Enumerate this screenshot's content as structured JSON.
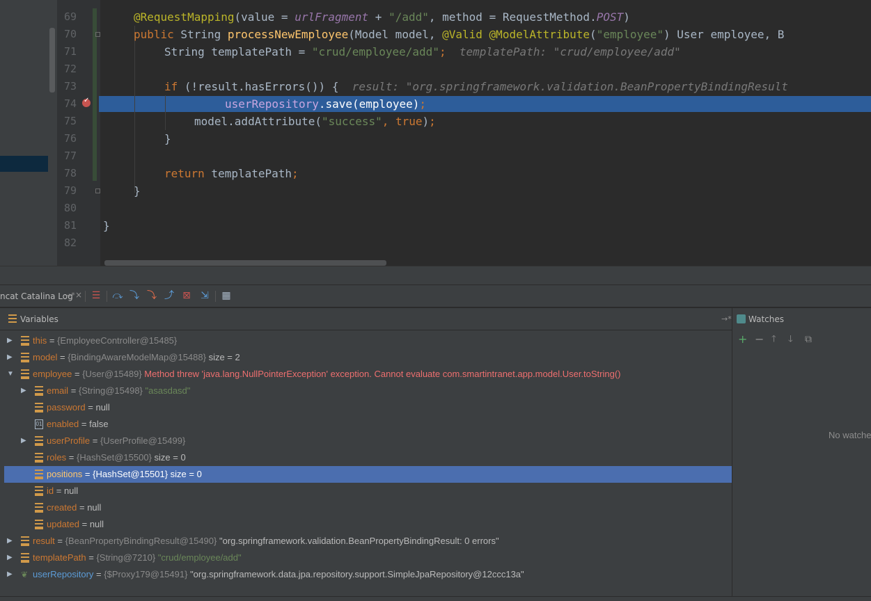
{
  "editor": {
    "line_numbers": [
      "69",
      "70",
      "71",
      "72",
      "73",
      "74",
      "75",
      "76",
      "77",
      "78",
      "79",
      "80",
      "81",
      "82"
    ],
    "line_69": {
      "annotation": "@RequestMapping",
      "p1": "(value = ",
      "frag": "urlFragment",
      "p2": " + ",
      "add": "\"/add\"",
      "p3": ", method = RequestMethod.",
      "post": "POST",
      "p4": ")"
    },
    "line_70": {
      "kw1": "public",
      "p1": " String ",
      "fn": "processNewEmployee",
      "p2": "(Model model, ",
      "an1": "@Valid",
      "sp": " ",
      "an2": "@ModelAttribute",
      "p3": "(",
      "str": "\"employee\"",
      "p4": ") User employee, B"
    },
    "line_71": {
      "p1": "String templatePath = ",
      "str": "\"crud/employee/add\"",
      "semi": ";",
      "hint": "  templatePath: \"crud/employee/add\""
    },
    "line_73": {
      "kw": "if",
      "p1": " (!result.hasErrors()) {",
      "hint": "  result: \"org.springframework.validation.BeanPropertyBindingResult"
    },
    "line_74": {
      "field": "userRepository",
      "p1": ".save(employee)",
      "semi": ";"
    },
    "line_75": {
      "p1": "model.addAttribute(",
      "str": "\"success\"",
      "comma": ", ",
      "kw": "true",
      "p2": ")",
      "semi": ";"
    },
    "line_76": "}",
    "line_78": {
      "kw": "return",
      "p1": " templatePath",
      "semi": ";"
    },
    "line_79": "}",
    "line_81": "}"
  },
  "debugger": {
    "tab_label": "ncat Catalina Log",
    "tab_pin": "→*",
    "tab_close": "×",
    "toolbar_icons": [
      "show-execution-point-icon",
      "step-over-icon",
      "step-into-icon",
      "force-step-into-icon",
      "step-out-icon",
      "drop-frame-icon",
      "run-to-cursor-icon",
      "evaluate-expression-icon"
    ]
  },
  "variables": {
    "title": "Variables",
    "pin": "→*",
    "rows": [
      {
        "name": "this",
        "eq": " = ",
        "ref": "{EmployeeController@15485}",
        "extra": "",
        "kind": "field",
        "level": 0,
        "toggle": "▶"
      },
      {
        "name": "model",
        "eq": " = ",
        "ref": "{BindingAwareModelMap@15488}",
        "extra": "  size = 2",
        "kind": "field",
        "level": 0,
        "toggle": "▶"
      },
      {
        "name": "employee",
        "eq": " = ",
        "ref": "{User@15489}",
        "extra": " Method threw 'java.lang.NullPointerException' exception. Cannot evaluate com.smartintranet.app.model.User.toString()",
        "extra_style": "err",
        "kind": "field",
        "level": 0,
        "toggle": "▼"
      },
      {
        "name": "email",
        "eq": " = ",
        "ref": "{String@15498}",
        "extra": " \"asasdasd\"",
        "extra_style": "str",
        "kind": "field",
        "level": 1,
        "toggle": "▶"
      },
      {
        "name": "password",
        "eq": " = ",
        "ref": "",
        "extra": "null",
        "kind": "field",
        "level": 1,
        "toggle": ""
      },
      {
        "name": "enabled",
        "eq": " = ",
        "ref": "",
        "extra": "false",
        "kind": "bool",
        "level": 1,
        "toggle": ""
      },
      {
        "name": "userProfile",
        "eq": " = ",
        "ref": "{UserProfile@15499}",
        "extra": "",
        "kind": "field",
        "level": 1,
        "toggle": "▶"
      },
      {
        "name": "roles",
        "eq": " = ",
        "ref": "{HashSet@15500}",
        "extra": "  size = 0",
        "kind": "field",
        "level": 1,
        "toggle": ""
      },
      {
        "name": "positions",
        "eq": " = ",
        "ref": "{HashSet@15501}",
        "extra": "  size = 0",
        "kind": "field",
        "level": 1,
        "toggle": "",
        "selected": true
      },
      {
        "name": "id",
        "eq": " = ",
        "ref": "",
        "extra": "null",
        "kind": "field",
        "level": 1,
        "toggle": ""
      },
      {
        "name": "created",
        "eq": " = ",
        "ref": "",
        "extra": "null",
        "kind": "field",
        "level": 1,
        "toggle": ""
      },
      {
        "name": "updated",
        "eq": " = ",
        "ref": "",
        "extra": "null",
        "kind": "field",
        "level": 1,
        "toggle": ""
      },
      {
        "name": "result",
        "eq": " = ",
        "ref": "{BeanPropertyBindingResult@15490}",
        "extra": " \"org.springframework.validation.BeanPropertyBindingResult: 0 errors\"",
        "kind": "field",
        "level": 0,
        "toggle": "▶"
      },
      {
        "name": "templatePath",
        "eq": " = ",
        "ref": "{String@7210}",
        "extra": " \"crud/employee/add\"",
        "extra_style": "str",
        "kind": "field",
        "level": 0,
        "toggle": "▶"
      },
      {
        "name": "userRepository",
        "eq": " = ",
        "ref": "{$Proxy179@15491}",
        "extra": " \"org.springframework.data.jpa.repository.support.SimpleJpaRepository@12ccc13a\"",
        "kind": "spring",
        "level": 0,
        "toggle": "▶"
      }
    ]
  },
  "watches": {
    "title": "Watches",
    "empty_text": "No watches",
    "actions": [
      "+",
      "−",
      "🡑",
      "🡓",
      "⧉"
    ],
    "action_icons": [
      "add-watch-icon",
      "remove-watch-icon",
      "move-up-icon",
      "move-down-icon",
      "duplicate-watch-icon"
    ]
  }
}
